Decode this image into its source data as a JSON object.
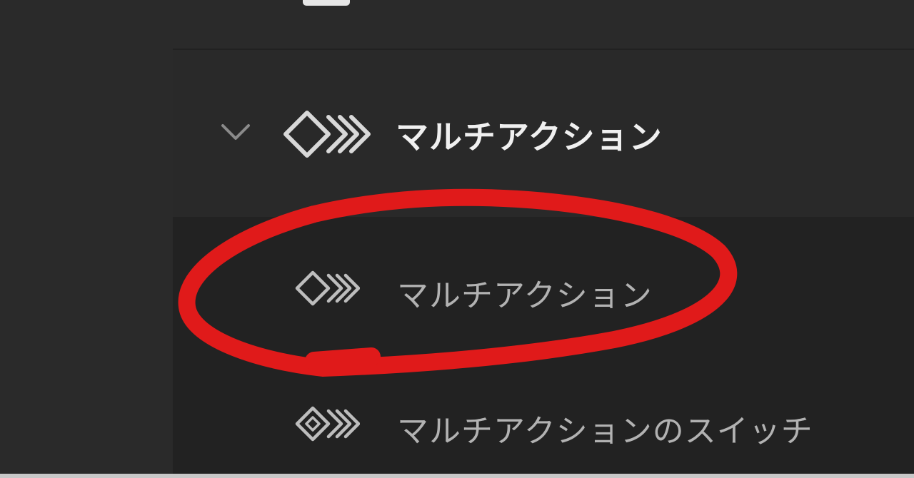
{
  "category": {
    "label": "マルチアクション",
    "expanded": true,
    "chevron_icon": "chevron-down-icon",
    "icon": "multi-action-icon"
  },
  "items": [
    {
      "label": "マルチアクション",
      "icon": "multi-action-icon",
      "highlighted": true
    },
    {
      "label": "マルチアクションのスイッチ",
      "icon": "multi-action-switch-icon",
      "highlighted": false
    }
  ],
  "annotation": {
    "type": "hand-drawn-ellipse",
    "color": "#e01a1a"
  },
  "colors": {
    "background": "#262626",
    "category_row": "#292929",
    "items_area": "#222222",
    "category_text": "#f0f0f0",
    "item_text": "#b2b2b2",
    "icon": "#d8d8d8"
  }
}
